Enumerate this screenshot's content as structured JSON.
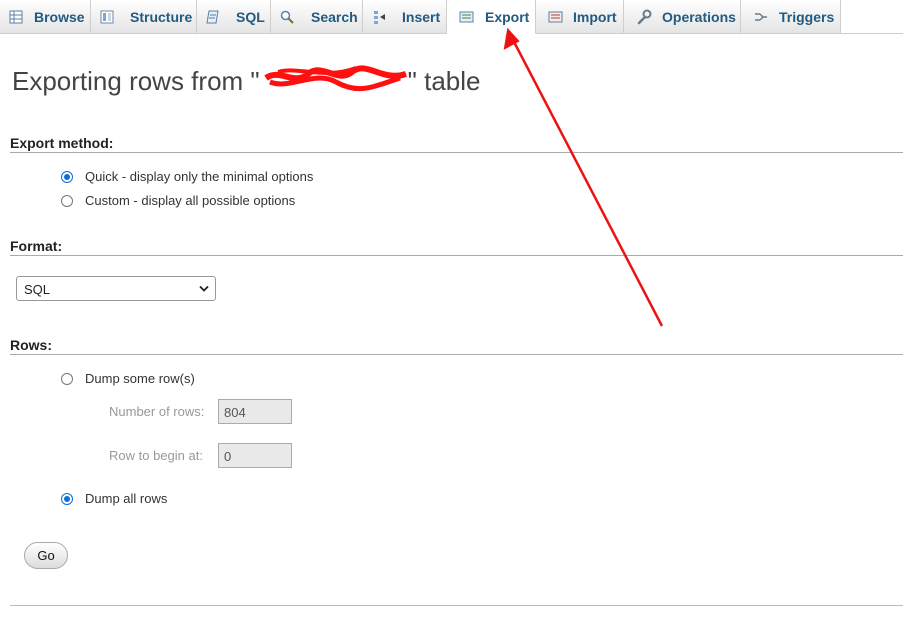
{
  "tabs": [
    {
      "label": "Browse",
      "icon": "browse-icon"
    },
    {
      "label": "Structure",
      "icon": "structure-icon"
    },
    {
      "label": "SQL",
      "icon": "sql-icon"
    },
    {
      "label": "Search",
      "icon": "search-icon"
    },
    {
      "label": "Insert",
      "icon": "insert-icon"
    },
    {
      "label": "Export",
      "icon": "export-icon",
      "active": true
    },
    {
      "label": "Import",
      "icon": "import-icon"
    },
    {
      "label": "Operations",
      "icon": "operations-icon"
    },
    {
      "label": "Triggers",
      "icon": "triggers-icon"
    }
  ],
  "page": {
    "title_prefix": "Exporting rows from \"",
    "title_suffix": "\" table"
  },
  "export_method": {
    "heading": "Export method:",
    "quick_label": "Quick - display only the minimal options",
    "custom_label": "Custom - display all possible options",
    "selected": "quick"
  },
  "format": {
    "heading": "Format:",
    "selected": "SQL"
  },
  "rows": {
    "heading": "Rows:",
    "dump_some_label": "Dump some row(s)",
    "number_of_rows_label": "Number of rows:",
    "number_of_rows_value": "804",
    "row_begin_label": "Row to begin at:",
    "row_begin_value": "0",
    "dump_all_label": "Dump all rows",
    "selected": "all"
  },
  "actions": {
    "go_label": "Go"
  },
  "colors": {
    "tab_text": "#235a81",
    "radio_selected": "#0b6fd8",
    "annotation": "#ee1111"
  }
}
